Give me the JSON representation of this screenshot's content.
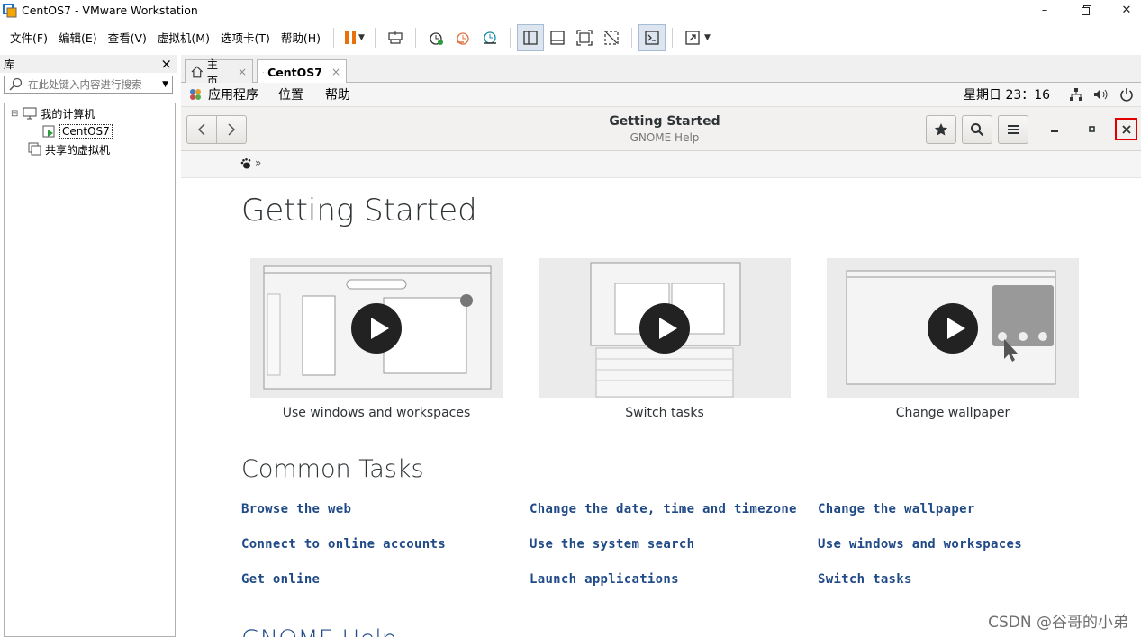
{
  "window": {
    "title": "CentOS7 - VMware Workstation",
    "minimize": "–",
    "maximize": "▭",
    "close": "✕"
  },
  "menubar": {
    "items": [
      "文件(F)",
      "编辑(E)",
      "查看(V)",
      "虚拟机(M)",
      "选项卡(T)",
      "帮助(H)"
    ],
    "toolbar_icons": [
      "pause-icon",
      "dropdown-icon",
      "send-ctrl-alt-del-icon",
      "snapshot-icon",
      "revert-snapshot-icon",
      "snapshot-manager-icon",
      "show-library-icon",
      "thumbnail-bar-icon",
      "full-screen-icon",
      "unity-icon",
      "console-view-icon",
      "stretch-guest-icon",
      "dropdown-icon"
    ]
  },
  "library": {
    "title": "库",
    "close": "×",
    "search_placeholder": "在此处键入内容进行搜索",
    "tree": [
      {
        "label": "我的计算机",
        "expander": "⊟"
      },
      {
        "label": "CentOS7"
      },
      {
        "label": "共享的虚拟机"
      }
    ]
  },
  "tabs": [
    {
      "label": "主页",
      "close": "×"
    },
    {
      "label": "CentOS7",
      "close": "×"
    }
  ],
  "gnome_panel": {
    "menus": [
      "应用程序",
      "位置",
      "帮助"
    ],
    "clock": "星期日 23：16"
  },
  "help_header": {
    "title": "Getting Started",
    "subtitle": "GNOME Help"
  },
  "breadcrumb": {
    "separator": "»"
  },
  "page": {
    "heading": "Getting Started",
    "videos": [
      {
        "caption": "Use windows and workspaces"
      },
      {
        "caption": "Switch tasks"
      },
      {
        "caption": "Change wallpaper"
      }
    ],
    "common_tasks_heading": "Common Tasks",
    "tasks": [
      [
        "Browse the web",
        "Change the date, time and timezone",
        "Change the wallpaper"
      ],
      [
        "Connect to online accounts",
        "Use the system search",
        "Use windows and workspaces"
      ],
      [
        "Get online",
        "Launch applications",
        "Switch tasks"
      ]
    ],
    "next_heading": "GNOME Help"
  },
  "watermark": "CSDN @谷哥的小弟",
  "colors": {
    "link": "#204a87",
    "accent_orange": "#e8710a",
    "highlight_red": "#e00000",
    "heading": "#2e3436"
  }
}
